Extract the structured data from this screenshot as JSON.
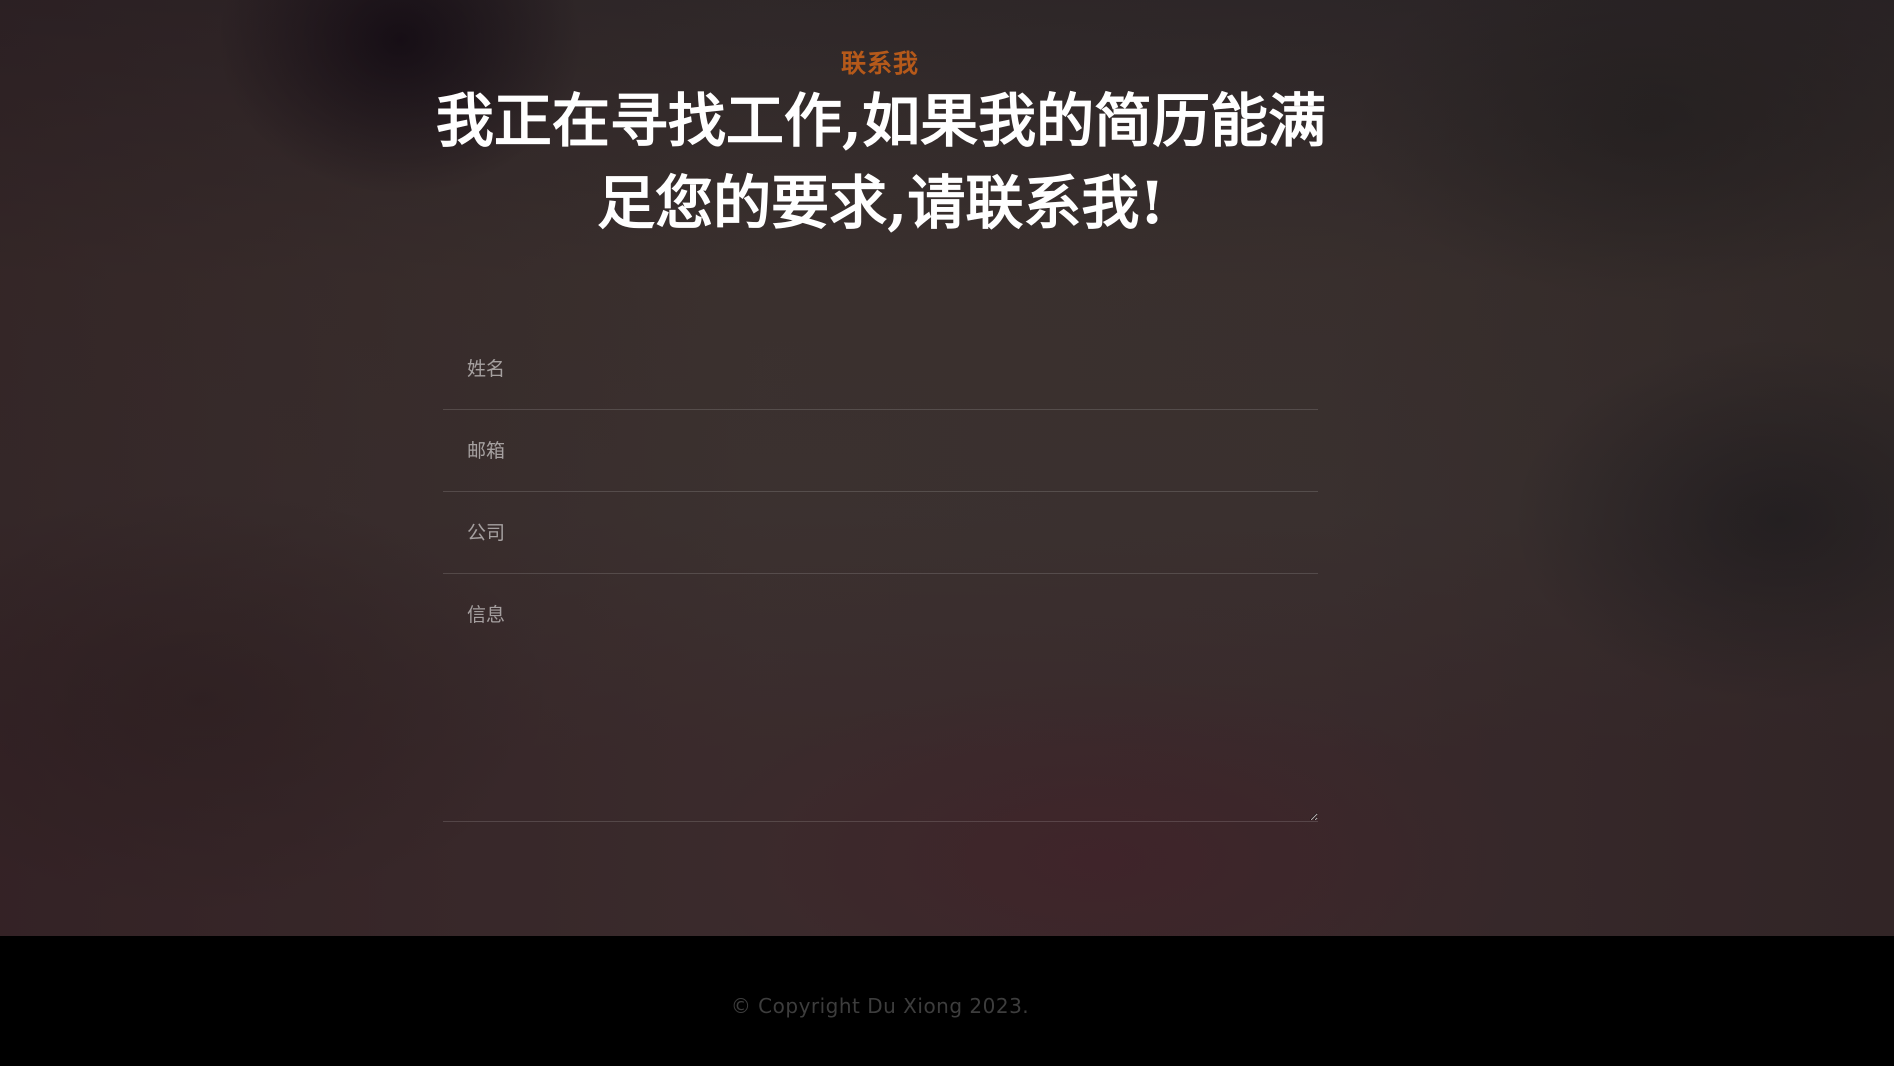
{
  "contact": {
    "eyebrow": "联系我",
    "headline": "我正在寻找工作,如果我的简历能满足您的要求,请联系我!",
    "form": {
      "name_placeholder": "姓名",
      "email_placeholder": "邮箱",
      "company_placeholder": "公司",
      "message_placeholder": "信息"
    }
  },
  "footer": {
    "copyright": "© Copyright Du Xiong 2023."
  },
  "colors": {
    "accent": "#b5591a",
    "headline": "#ffffff",
    "footer_bg": "#000000"
  }
}
